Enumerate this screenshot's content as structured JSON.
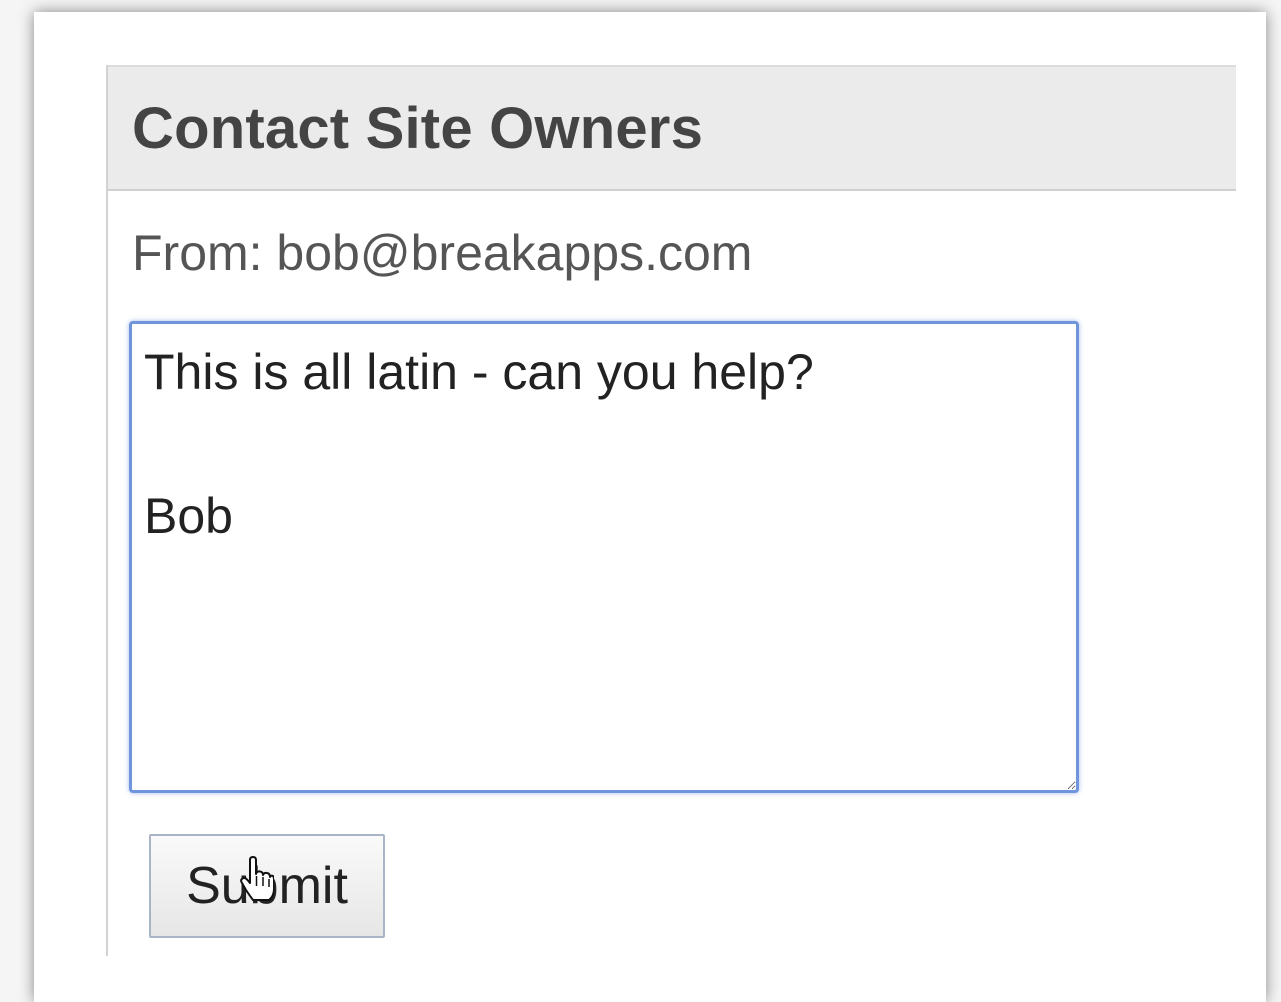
{
  "contact_form": {
    "title": "Contact Site Owners",
    "from_label": "From: bob@breakapps.com",
    "message_value": "This is all latin - can you help?\n\nBob",
    "submit_label": "Submit"
  },
  "pointer": {
    "icon": "hand-pointer-icon"
  },
  "colors": {
    "focus_border": "#6f95dc",
    "header_bg": "#ebebeb",
    "title_text": "#444444"
  }
}
